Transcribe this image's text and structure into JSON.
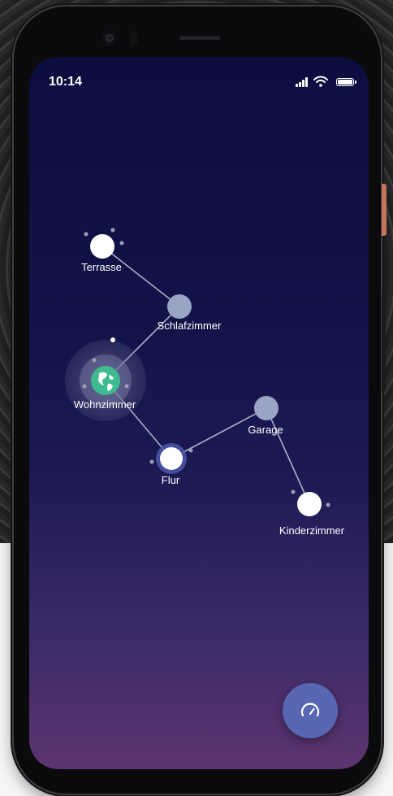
{
  "status_bar": {
    "time": "10:14",
    "icons": [
      "cellular-signal-icon",
      "wifi-icon",
      "battery-icon"
    ]
  },
  "network_map": {
    "nodes": [
      {
        "id": "terrasse",
        "label": "Terrasse",
        "color": "#ffffff",
        "state": "online"
      },
      {
        "id": "schlafzimmer",
        "label": "Schlafzimmer",
        "color": "#9aa4c4",
        "state": "idle"
      },
      {
        "id": "wohnzimmer",
        "label": "Wohnzimmer",
        "color": "#3dba8f",
        "state": "gateway",
        "icon": "globe-icon"
      },
      {
        "id": "flur",
        "label": "Flur",
        "color": "#ffffff",
        "state": "active"
      },
      {
        "id": "garage",
        "label": "Garage",
        "color": "#9aa4c4",
        "state": "idle"
      },
      {
        "id": "kinderzimmer",
        "label": "Kinderzimmer",
        "color": "#ffffff",
        "state": "online"
      }
    ],
    "links": [
      [
        "terrasse",
        "schlafzimmer"
      ],
      [
        "schlafzimmer",
        "wohnzimmer"
      ],
      [
        "wohnzimmer",
        "flur"
      ],
      [
        "flur",
        "garage"
      ],
      [
        "garage",
        "kinderzimmer"
      ]
    ]
  },
  "speed_test_button": {
    "icon": "speedometer-icon",
    "color": "#5866b4"
  }
}
